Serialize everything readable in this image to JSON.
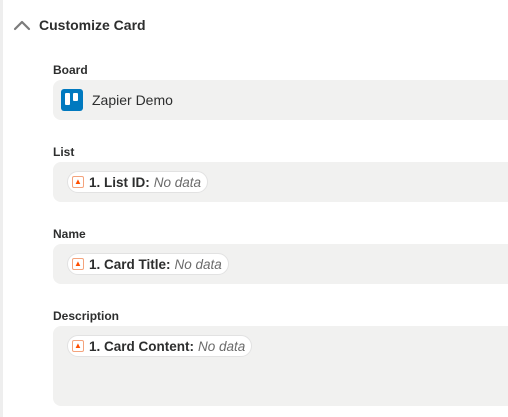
{
  "section": {
    "title": "Customize Card"
  },
  "fields": {
    "board": {
      "label": "Board",
      "value": "Zapier Demo",
      "icon": "trello-icon",
      "icon_color": "#0079bf"
    },
    "list": {
      "label": "List",
      "pill_key": "1. List ID:",
      "pill_value": "No data"
    },
    "name": {
      "label": "Name",
      "pill_key": "1. Card Title:",
      "pill_value": "No data"
    },
    "description": {
      "label": "Description",
      "pill_key": "1. Card Content:",
      "pill_value": "No data"
    }
  },
  "colors": {
    "field_background": "#f1f1f0",
    "pill_icon_accent": "#ff4f00"
  }
}
